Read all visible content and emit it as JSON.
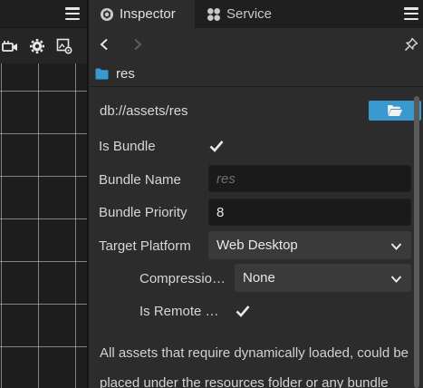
{
  "tabs": {
    "inspector": {
      "label": "Inspector",
      "icon": "inspector-icon"
    },
    "service": {
      "label": "Service",
      "icon": "service-icon"
    }
  },
  "scene_panel": {
    "menu_icon": "hamburger-icon",
    "toolbar_icons": [
      "camera-icon",
      "gear-icon",
      "image-settings-icon"
    ]
  },
  "inspector": {
    "menu_icon": "hamburger-icon",
    "nav": {
      "back_icon": "chevron-left-icon",
      "forward_icon": "chevron-right-icon",
      "pin_icon": "pin-icon"
    },
    "asset": {
      "icon": "folder-icon",
      "name": "res"
    },
    "path": "db://assets/res",
    "open_button_icon": "folder-open-icon",
    "props": {
      "is_bundle": {
        "label": "Is Bundle",
        "checked": true
      },
      "bundle_name": {
        "label": "Bundle Name",
        "value": "",
        "placeholder": "res"
      },
      "bundle_priority": {
        "label": "Bundle Priority",
        "value": "8"
      },
      "target_platform": {
        "label": "Target Platform",
        "value": "Web Desktop"
      },
      "compression": {
        "label": "Compressio…",
        "value": "None"
      },
      "is_remote": {
        "label": "Is Remote …",
        "checked": true
      }
    },
    "description_lines": [
      "All assets that require dynamically loaded, could be",
      "placed under the resources folder or any bundle"
    ]
  },
  "colors": {
    "accent_button": "#3a9ad0",
    "folder_icon": "#3a9ad0",
    "panel_bg": "#2c2c2c",
    "header_bg": "#1f1f1f"
  }
}
